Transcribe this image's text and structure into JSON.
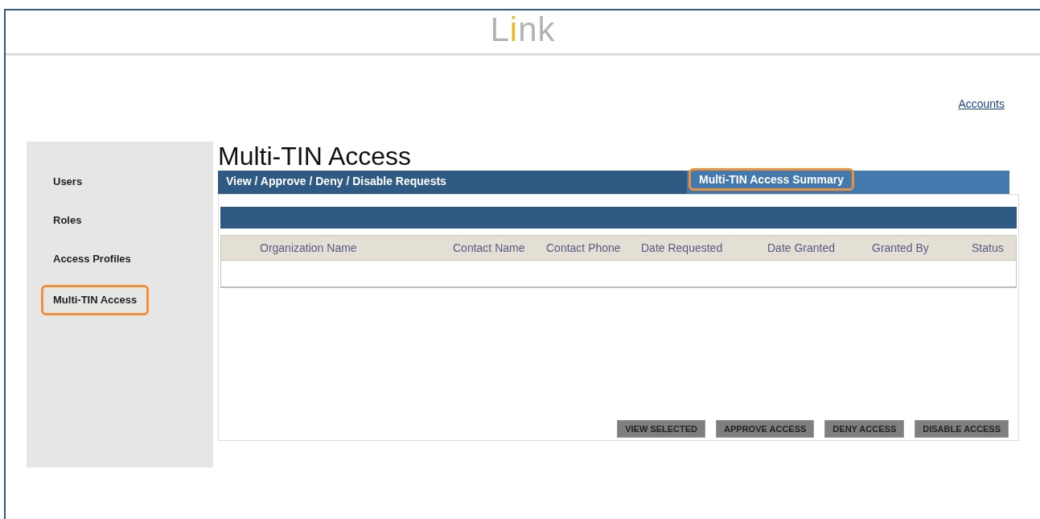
{
  "logo": {
    "parts": [
      {
        "text": "L",
        "color": "#b3b3b3"
      },
      {
        "text": "i",
        "color": "#e8b830"
      },
      {
        "text": "nk",
        "color": "#b3b3b3"
      }
    ]
  },
  "accounts_link": "Accounts",
  "sidebar": {
    "items": [
      {
        "label": "Users",
        "highlighted": false
      },
      {
        "label": "Roles",
        "highlighted": false
      },
      {
        "label": "Access Profiles",
        "highlighted": false
      },
      {
        "label": "Multi-TIN Access",
        "highlighted": true
      }
    ]
  },
  "page_title": "Multi-TIN Access",
  "tabs": [
    {
      "label": "View / Approve / Deny / Disable Requests",
      "selected": true,
      "highlighted": false
    },
    {
      "label": "Multi-TIN Access Summary",
      "selected": false,
      "highlighted": true
    }
  ],
  "table": {
    "columns": [
      "Organization Name",
      "Contact Name",
      "Contact Phone",
      "Date Requested",
      "Date Granted",
      "Granted By",
      "Status"
    ]
  },
  "buttons": [
    "VIEW SELECTED",
    "APPROVE ACCESS",
    "DENY ACCESS",
    "DISABLE ACCESS"
  ]
}
